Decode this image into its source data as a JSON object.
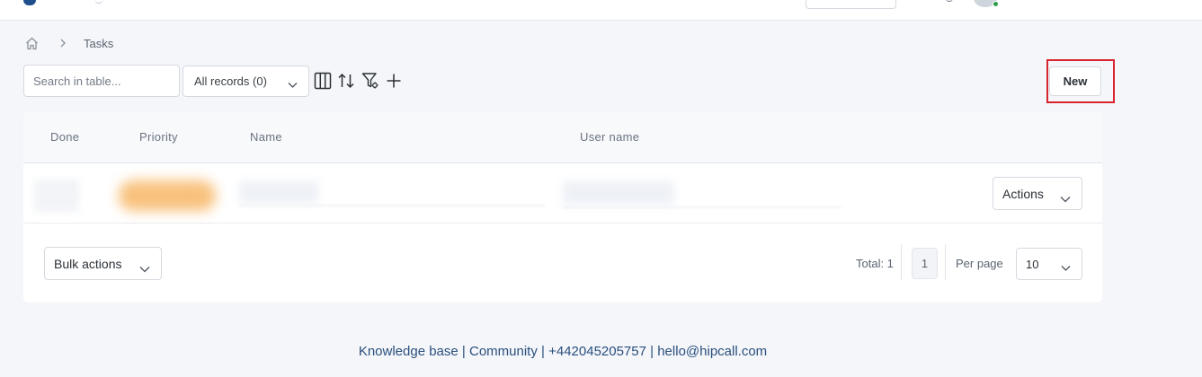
{
  "breadcrumb": {
    "current": "Tasks"
  },
  "toolbar": {
    "search_placeholder": "Search in table...",
    "records_filter": "All records (0)",
    "new_label": "New"
  },
  "table": {
    "columns": [
      "Done",
      "Priority",
      "Name",
      "User name"
    ],
    "row_actions_label": "Actions"
  },
  "table_footer": {
    "bulk_actions_label": "Bulk actions",
    "total_text": "Total: 1",
    "current_page": "1",
    "per_page_label": "Per page",
    "per_page_value": "10"
  },
  "footer": {
    "links": [
      "Knowledge base",
      "Community",
      "+442045205757",
      "hello@hipcall.com"
    ],
    "separator": "|"
  },
  "colors": {
    "accent": "#2a4f7e",
    "highlight_border": "#d9232e",
    "online_status": "#2e9e4a"
  }
}
